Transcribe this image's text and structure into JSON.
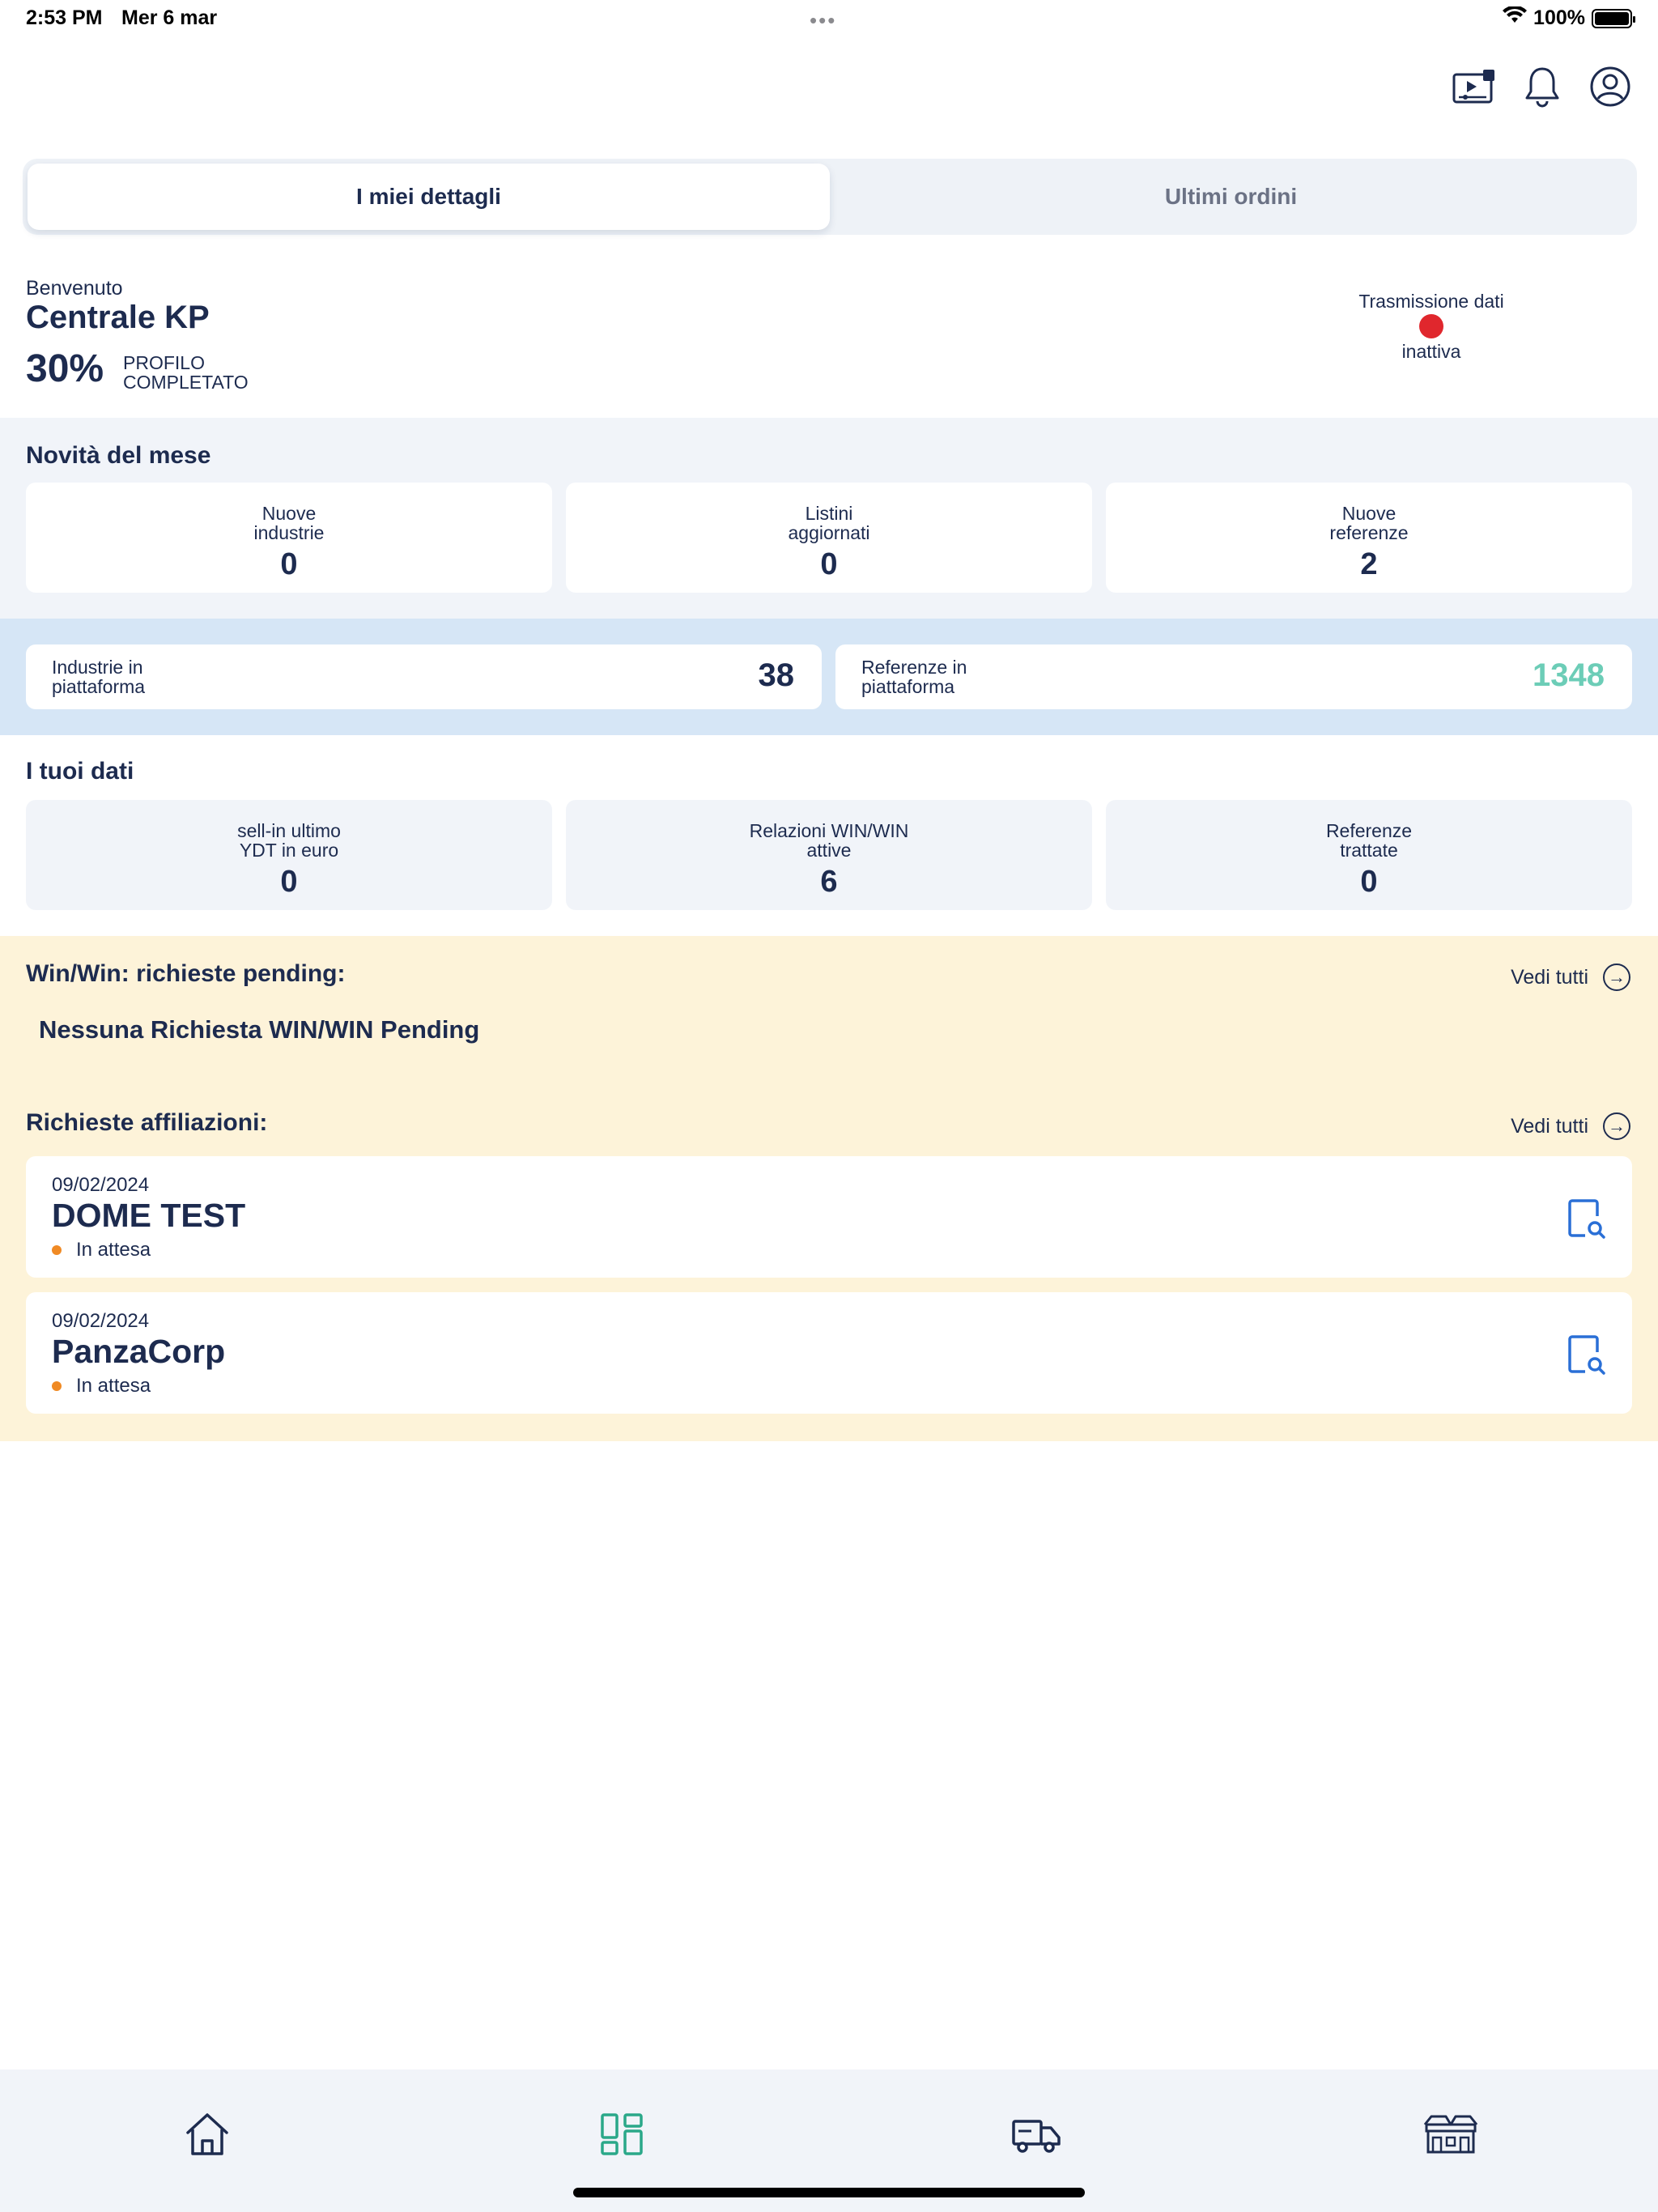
{
  "status_bar": {
    "time": "2:53 PM",
    "date": "Mer 6 mar",
    "battery": "100%",
    "icons": [
      "wifi-icon",
      "battery-icon"
    ]
  },
  "header": {
    "icons": [
      "video-tutorial-icon",
      "bell-icon",
      "user-profile-icon"
    ]
  },
  "tabs": {
    "active": "I miei dettagli",
    "inactive": "Ultimi ordini"
  },
  "profile": {
    "welcome": "Benvenuto",
    "company_name": "Centrale KP",
    "completion_percent": "30%",
    "completion_label": "PROFILO COMPLETATO",
    "transmission_label": "Trasmissione dati",
    "transmission_status": "inattiva",
    "transmission_color": "#e0272d"
  },
  "monthly_news": {
    "title": "Novità del mese",
    "cards": [
      {
        "label": "Nuove industrie",
        "value": "0"
      },
      {
        "label": "Listini aggiornati",
        "value": "0"
      },
      {
        "label": "Nuove referenze",
        "value": "2"
      }
    ]
  },
  "platform": {
    "industries": {
      "label": "Industrie in piattaforma",
      "value": "38"
    },
    "references": {
      "label": "Referenze in piattaforma",
      "value": "1348",
      "color": "#6ccdb7"
    }
  },
  "your_data": {
    "title": "I tuoi dati",
    "cards": [
      {
        "label": "sell-in ultimo YDT in euro",
        "value": "0"
      },
      {
        "label": "Relazioni WIN/WIN attive",
        "value": "6"
      },
      {
        "label": "Referenze trattate",
        "value": "0"
      }
    ]
  },
  "winwin": {
    "title": "Win/Win: richieste pending:",
    "see_all": "Vedi tutti",
    "empty_message": "Nessuna Richiesta WIN/WIN Pending"
  },
  "affiliations": {
    "title": "Richieste affiliazioni:",
    "see_all": "Vedi tutti",
    "items": [
      {
        "date": "09/02/2024",
        "name": "DOME TEST",
        "status": "In attesa"
      },
      {
        "date": "09/02/2024",
        "name": "PanzaCorp",
        "status": "In attesa"
      }
    ],
    "status_color": "#f08a24"
  },
  "bottom_nav": {
    "items": [
      "home-icon",
      "dashboard-icon",
      "delivery-truck-icon",
      "stores-icon"
    ],
    "active": "dashboard-icon",
    "active_color": "#2aa889"
  }
}
